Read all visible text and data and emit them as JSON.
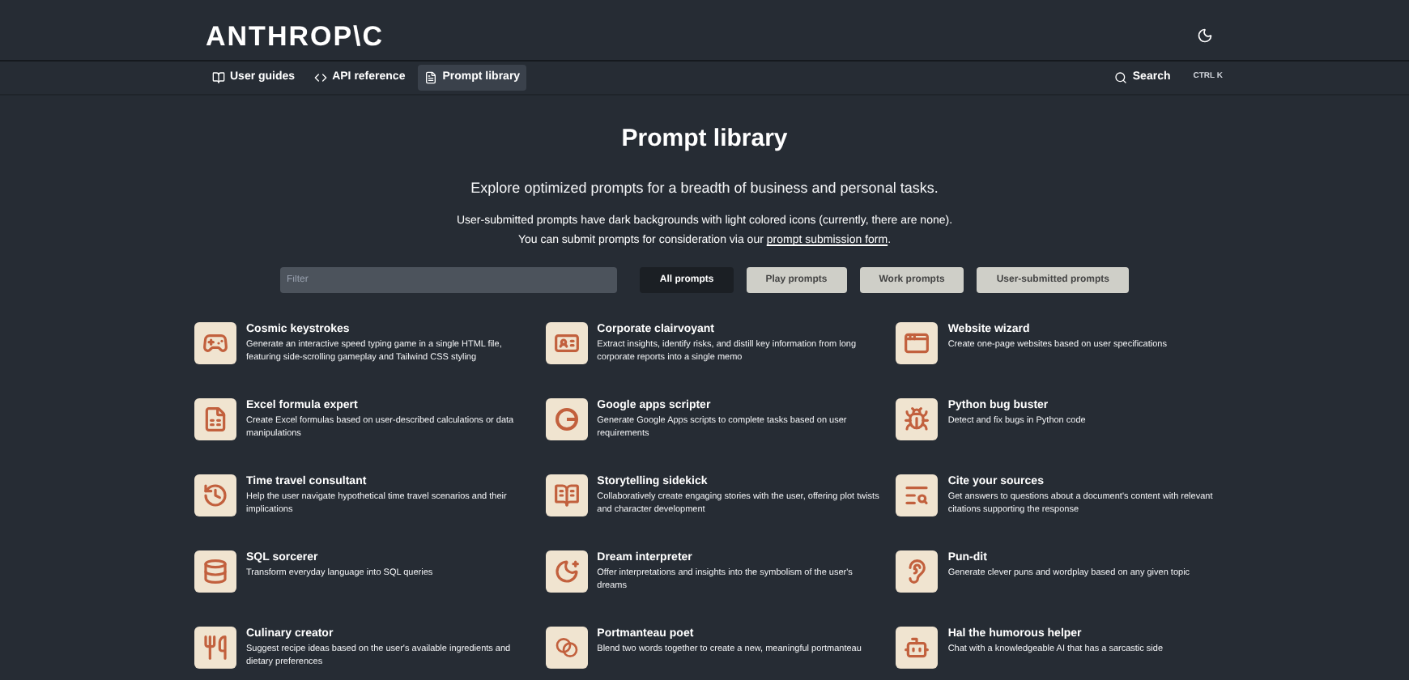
{
  "header": {
    "logo": "ANTHROP\\C"
  },
  "nav": [
    {
      "label": "User guides",
      "selected": false
    },
    {
      "label": "API reference",
      "selected": false
    },
    {
      "label": "Prompt library",
      "selected": true
    }
  ],
  "search": {
    "label": "Search",
    "shortcut": "CTRL K"
  },
  "title": "Prompt library",
  "subtitle": "Explore optimized prompts for a breadth of business and personal tasks.",
  "note": {
    "line1": "User-submitted prompts have dark backgrounds with light colored icons (currently, there are none).",
    "line2_before": "You can submit prompts for consideration via our ",
    "link": "prompt submission form",
    "line2_after": "."
  },
  "filter": {
    "placeholder": "Filter"
  },
  "tabs": [
    {
      "label": "All prompts",
      "selected": true
    },
    {
      "label": "Play prompts",
      "selected": false
    },
    {
      "label": "Work prompts",
      "selected": false
    },
    {
      "label": "User-submitted prompts",
      "selected": false
    }
  ],
  "prompts": [
    {
      "title": "Cosmic keystrokes",
      "description": "Generate an interactive speed typing game in a single HTML file, featuring side-scrolling gameplay and Tailwind CSS styling"
    },
    {
      "title": "Corporate clairvoyant",
      "description": "Extract insights, identify risks, and distill key information from long corporate reports into a single memo"
    },
    {
      "title": "Website wizard",
      "description": "Create one-page websites based on user specifications"
    },
    {
      "title": "Excel formula expert",
      "description": "Create Excel formulas based on user-described calculations or data manipulations"
    },
    {
      "title": "Google apps scripter",
      "description": "Generate Google Apps scripts to complete tasks based on user requirements"
    },
    {
      "title": "Python bug buster",
      "description": "Detect and fix bugs in Python code"
    },
    {
      "title": "Time travel consultant",
      "description": "Help the user navigate hypothetical time travel scenarios and their implications"
    },
    {
      "title": "Storytelling sidekick",
      "description": "Collaboratively create engaging stories with the user, offering plot twists and character development"
    },
    {
      "title": "Cite your sources",
      "description": "Get answers to questions about a document's content with relevant citations supporting the response"
    },
    {
      "title": "SQL sorcerer",
      "description": "Transform everyday language into SQL queries"
    },
    {
      "title": "Dream interpreter",
      "description": "Offer interpretations and insights into the symbolism of the user's dreams"
    },
    {
      "title": "Pun-dit",
      "description": "Generate clever puns and wordplay based on any given topic"
    },
    {
      "title": "Culinary creator",
      "description": "Suggest recipe ideas based on the user's available ingredients and dietary preferences"
    },
    {
      "title": "Portmanteau poet",
      "description": "Blend two words together to create a new, meaningful portmanteau"
    },
    {
      "title": "Hal the humorous helper",
      "description": "Chat with a knowledgeable AI that has a sarcastic side"
    }
  ]
}
